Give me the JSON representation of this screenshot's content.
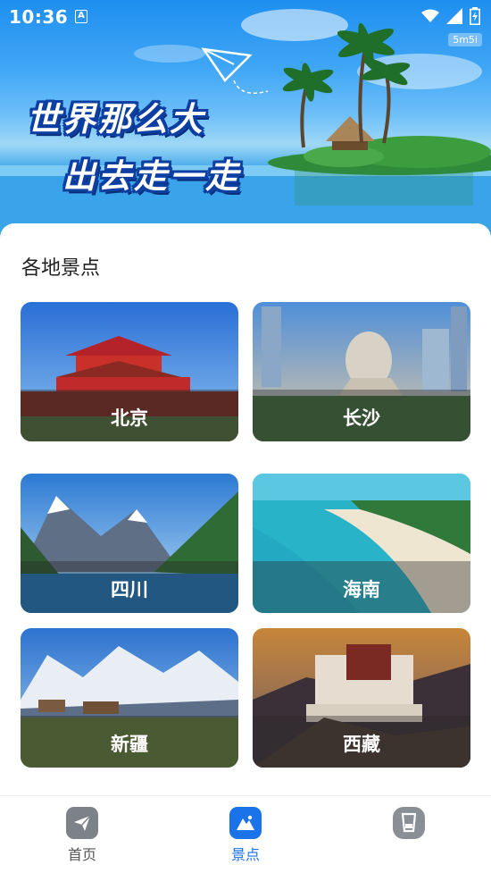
{
  "status_bar": {
    "time": "10:36",
    "notification_icon": "A",
    "icons": [
      "wifi-icon",
      "signal-icon",
      "battery-icon"
    ]
  },
  "hero": {
    "badge": "5m5i",
    "slogan_line1": "世界那么大",
    "slogan_line2": "出去走一走"
  },
  "section": {
    "title": "各地景点"
  },
  "destinations": [
    {
      "label": "北京",
      "scene": "gate"
    },
    {
      "label": "长沙",
      "scene": "statue"
    },
    {
      "label": "四川",
      "scene": "lake"
    },
    {
      "label": "海南",
      "scene": "beach"
    },
    {
      "label": "新疆",
      "scene": "snow"
    },
    {
      "label": "西藏",
      "scene": "palace"
    }
  ],
  "bottom_nav": {
    "items": [
      {
        "label": "首页",
        "icon": "paper-plane-icon",
        "active": false
      },
      {
        "label": "景点",
        "icon": "mountain-icon",
        "active": true
      },
      {
        "label": "",
        "icon": "cup-icon",
        "active": false
      }
    ],
    "active_color": "#1a73e8",
    "inactive_color": "#555555"
  }
}
